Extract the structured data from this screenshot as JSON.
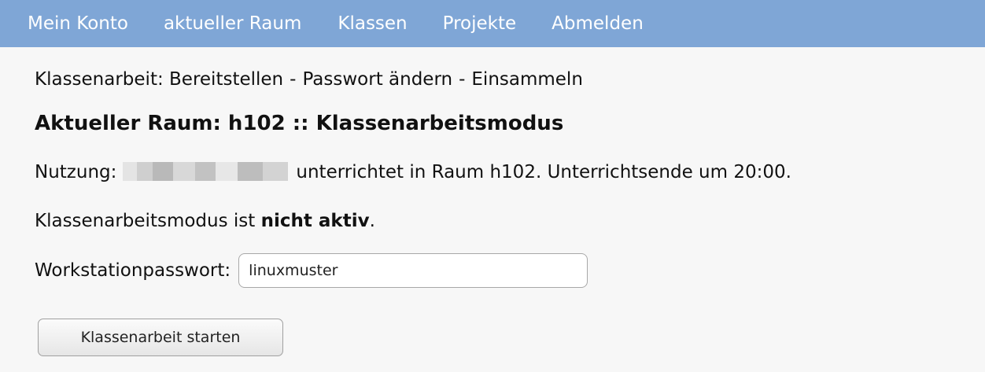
{
  "nav": {
    "items": [
      {
        "label": "Mein Konto"
      },
      {
        "label": "aktueller Raum"
      },
      {
        "label": "Klassen"
      },
      {
        "label": "Projekte"
      },
      {
        "label": "Abmelden"
      }
    ]
  },
  "breadcrumb": {
    "prefix": "Klassenarbeit:",
    "links": [
      "Bereitstellen",
      "Passwort ändern",
      "Einsammeln"
    ],
    "separator": "-"
  },
  "heading": "Aktueller Raum: h102 :: Klassenarbeitsmodus",
  "usage": {
    "label": "Nutzung:",
    "text": "unterrichtet in Raum h102. Unterrichtsende um 20:00."
  },
  "mode": {
    "text": "Klassenarbeitsmodus ist",
    "status": "nicht aktiv",
    "suffix": "."
  },
  "password": {
    "label": "Workstationpasswort:",
    "value": "linuxmuster"
  },
  "start_button": {
    "label": "Klassenarbeit starten"
  },
  "colors": {
    "nav_bg": "#7fa6d6",
    "page_bg": "#f7f7f7"
  }
}
